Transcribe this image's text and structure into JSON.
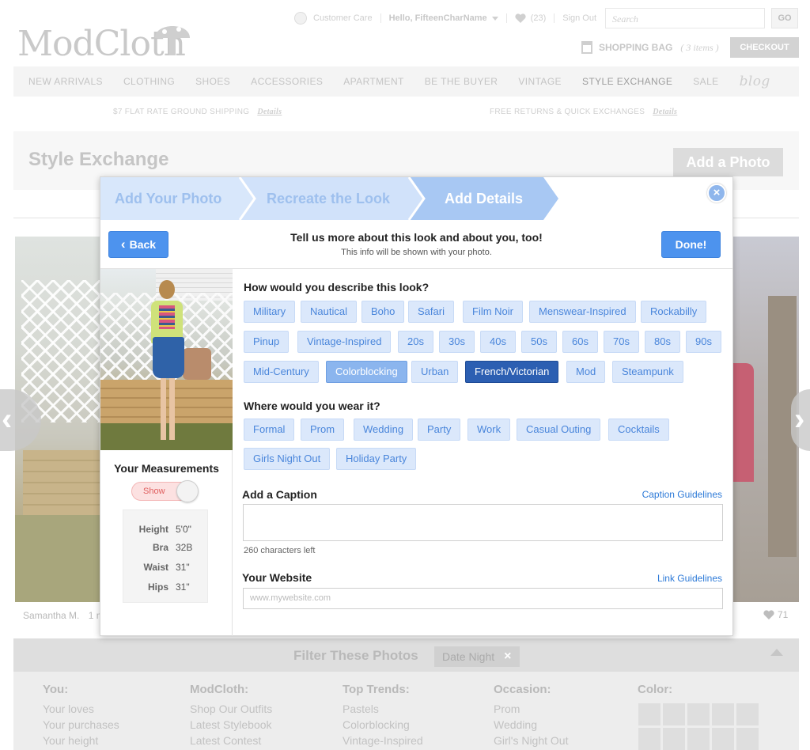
{
  "header": {
    "logo_text": "ModCloth",
    "customer_care": "Customer Care",
    "hello": "Hello, FifteenCharName",
    "likes_count": "(23)",
    "sign_out": "Sign Out",
    "search_placeholder": "Search",
    "go_label": "GO",
    "bag_label": "SHOPPING BAG",
    "bag_count": "( 3 items )",
    "checkout_label": "CHECKOUT"
  },
  "nav": {
    "items": [
      "NEW ARRIVALS",
      "CLOTHING",
      "SHOES",
      "ACCESSORIES",
      "APARTMENT",
      "BE THE BUYER",
      "VINTAGE",
      "STYLE EXCHANGE",
      "SALE"
    ],
    "blog": "blog",
    "active": "STYLE EXCHANGE"
  },
  "promo": {
    "left": "$7 FLAT RATE GROUND SHIPPING",
    "left_link": "Details",
    "right": "FREE RETURNS & QUICK EXCHANGES",
    "right_link": "Details"
  },
  "page": {
    "title": "Style Exchange",
    "add_photo": "Add a Photo",
    "photo_user": "Samantha M.",
    "photo_time": "1 m",
    "photo_likes": "71"
  },
  "filter": {
    "title": "Filter These Photos",
    "active_tag": "Date Night",
    "columns": [
      {
        "heading": "You:",
        "items": [
          "Your loves",
          "Your purchases",
          "Your height"
        ]
      },
      {
        "heading": "ModCloth:",
        "items": [
          "Shop Our Outfits",
          "Latest Stylebook",
          "Latest Contest"
        ]
      },
      {
        "heading": "Top Trends:",
        "items": [
          "Pastels",
          "Colorblocking",
          "Vintage-Inspired"
        ]
      },
      {
        "heading": "Occasion:",
        "items": [
          "Prom",
          "Wedding",
          "Girl's Night Out"
        ]
      },
      {
        "heading": "Color:",
        "items": []
      }
    ]
  },
  "modal": {
    "steps": [
      "Add Your Photo",
      "Recreate the Look",
      "Add Details"
    ],
    "close_glyph": "×",
    "back_label": "Back",
    "done_label": "Done!",
    "title": "Tell us more about this look and about you, too!",
    "subtitle": "This info will be shown with your photo.",
    "measurements": {
      "title": "Your Measurements",
      "toggle": "Show",
      "rows": [
        {
          "k": "Height",
          "v": "5'0\""
        },
        {
          "k": "Bra",
          "v": "32B"
        },
        {
          "k": "Waist",
          "v": "31\""
        },
        {
          "k": "Hips",
          "v": "31\""
        }
      ]
    },
    "look_question": "How would you describe this look?",
    "look_tags": [
      "Military",
      "Nautical",
      "Boho",
      "Safari",
      "Film Noir",
      "Menswear-Inspired",
      "Rockabilly",
      "Pinup",
      "Vintage-Inspired",
      "20s",
      "30s",
      "40s",
      "50s",
      "60s",
      "70s",
      "80s",
      "90s",
      "Mid-Century",
      "Colorblocking",
      "Urban",
      "French/Victorian",
      "Mod",
      "Steampunk"
    ],
    "look_selected_light": [
      "Colorblocking"
    ],
    "look_selected_dark": [
      "French/Victorian"
    ],
    "wear_question": "Where would you wear it?",
    "wear_tags": [
      "Formal",
      "Prom",
      "Wedding",
      "Party",
      "Work",
      "Casual Outing",
      "Cocktails",
      "Girls Night Out",
      "Holiday Party"
    ],
    "caption_label": "Add a Caption",
    "caption_guidelines": "Caption Guidelines",
    "caption_value": "",
    "chars_left": "260 characters left",
    "website_label": "Your Website",
    "link_guidelines": "Link Guidelines",
    "website_placeholder": "www.mywebsite.com"
  },
  "colors": {
    "accent": "#4d93ee",
    "tag_bg": "#dbe8fb",
    "tag_text": "#4a86db",
    "selected_dark": "#2c5fb2",
    "selected_light": "#8bb5ee"
  }
}
